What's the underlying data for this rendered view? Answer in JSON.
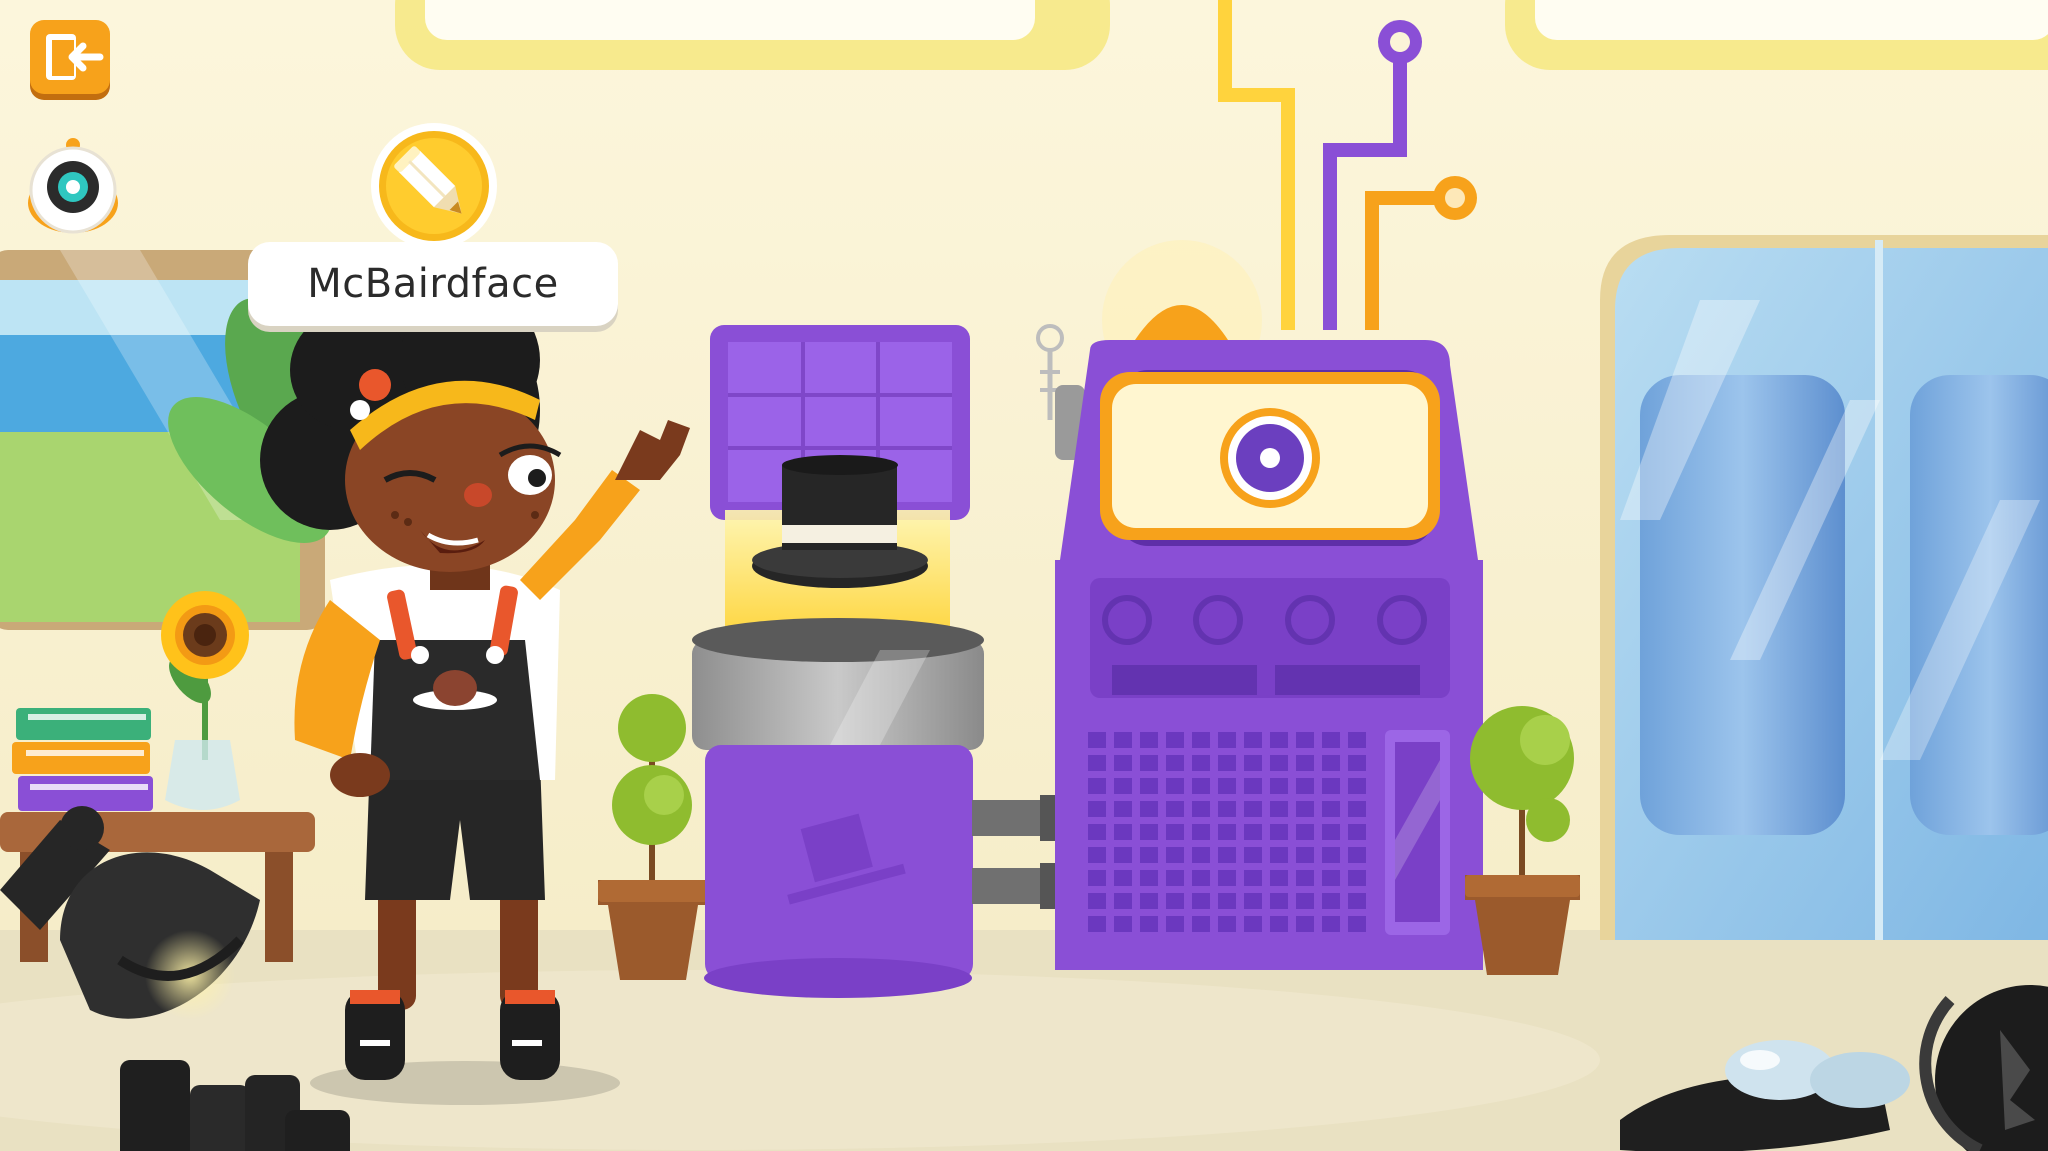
{
  "character": {
    "name": "McBairdface"
  },
  "icons": {
    "exit": "exit-door-icon",
    "robot": "robot-eye-icon",
    "edit": "pencil-icon"
  },
  "colors": {
    "accent_orange": "#f7a21b",
    "machine_purple": "#8a4fd6",
    "machine_purple_dark": "#5e2fa8",
    "screen_yellow": "#ffd33d",
    "wall": "#fbf4d8",
    "floor": "#ebe4c6"
  }
}
